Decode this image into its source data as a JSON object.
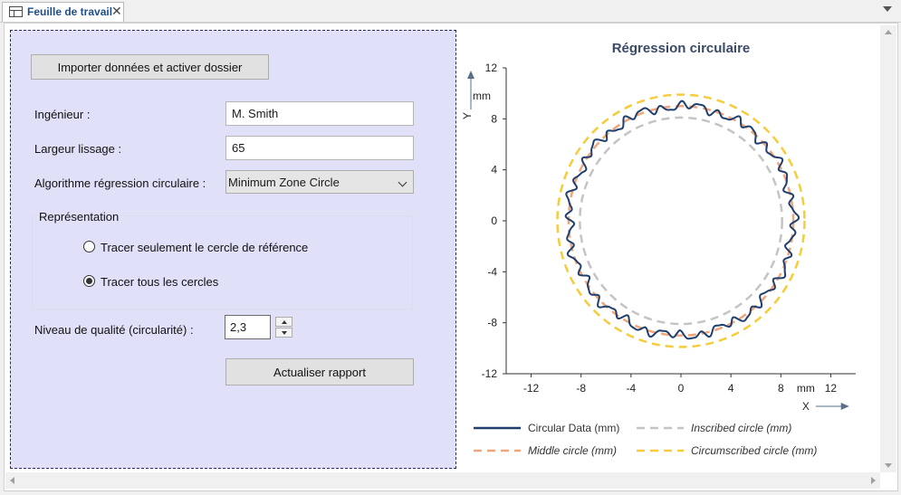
{
  "tab": {
    "label": "Feuille de travail",
    "close_glyph": "✕",
    "icon": "table-icon"
  },
  "form": {
    "import_button": "Importer données et activer dossier",
    "engineer_label": "Ingénieur :",
    "engineer_value": "M. Smith",
    "smoothing_label": "Largeur lissage :",
    "smoothing_value": "65",
    "algorithm_label": "Algorithme régression circulaire :",
    "algorithm_value": "Minimum Zone Circle",
    "representation_title": "Représentation",
    "radio_reference": "Tracer seulement le cercle de référence",
    "radio_all": "Tracer tous les cercles",
    "radio_selected": "all",
    "quality_label": "Niveau de qualité (circularité) :",
    "quality_value": "2,3",
    "update_button": "Actualiser rapport"
  },
  "chart_data": {
    "type": "line",
    "title": "Régression circulaire",
    "xlabel": "X",
    "ylabel": "Y",
    "x_unit": "mm",
    "y_unit": "mm",
    "xlim": [
      -14,
      14
    ],
    "ylim": [
      -12,
      12
    ],
    "xticks": [
      -12,
      -8,
      -4,
      0,
      4,
      8,
      12
    ],
    "yticks": [
      -12,
      -8,
      -4,
      0,
      4,
      8,
      12
    ],
    "series": [
      {
        "name": "Circular Data (mm)",
        "kind": "profile",
        "radius": 9.0,
        "ripple": 0.45,
        "color": "#1f3f6e",
        "dash": false,
        "italic": false
      },
      {
        "name": "Inscribed circle (mm)",
        "kind": "circle",
        "radius": 8.1,
        "color": "#c4c4c4",
        "dash": true,
        "italic": true
      },
      {
        "name": "Middle circle (mm)",
        "kind": "circle",
        "radius": 9.0,
        "color": "#f0a57a",
        "dash": true,
        "italic": true
      },
      {
        "name": "Circumscribed circle (mm)",
        "kind": "circle",
        "radius": 9.9,
        "color": "#f5cc3a",
        "dash": true,
        "italic": true
      }
    ]
  },
  "colors": {
    "panel_bg": "#e0e0f8",
    "title": "#3a4a66"
  }
}
